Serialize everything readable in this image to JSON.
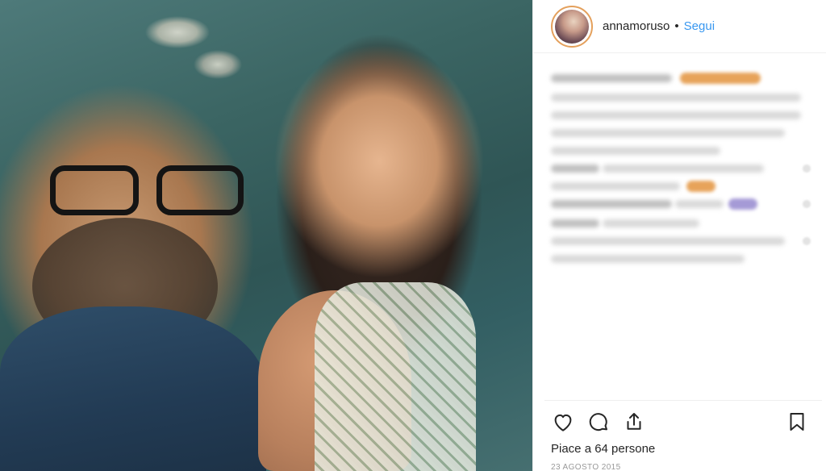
{
  "header": {
    "username": "annamoruso",
    "separator": "•",
    "follow_label": "Segui"
  },
  "photo": {
    "description_icon": "post-photo"
  },
  "actions": {
    "like_icon": "heart-icon",
    "comment_icon": "comment-icon",
    "share_icon": "share-icon",
    "save_icon": "bookmark-icon"
  },
  "likes_text": "Piace a 64 persone",
  "date_text": "23 AGOSTO 2015",
  "colors": {
    "link_blue": "#3897f0",
    "text_dark": "#262626",
    "muted": "#999999",
    "divider": "#efefef"
  }
}
